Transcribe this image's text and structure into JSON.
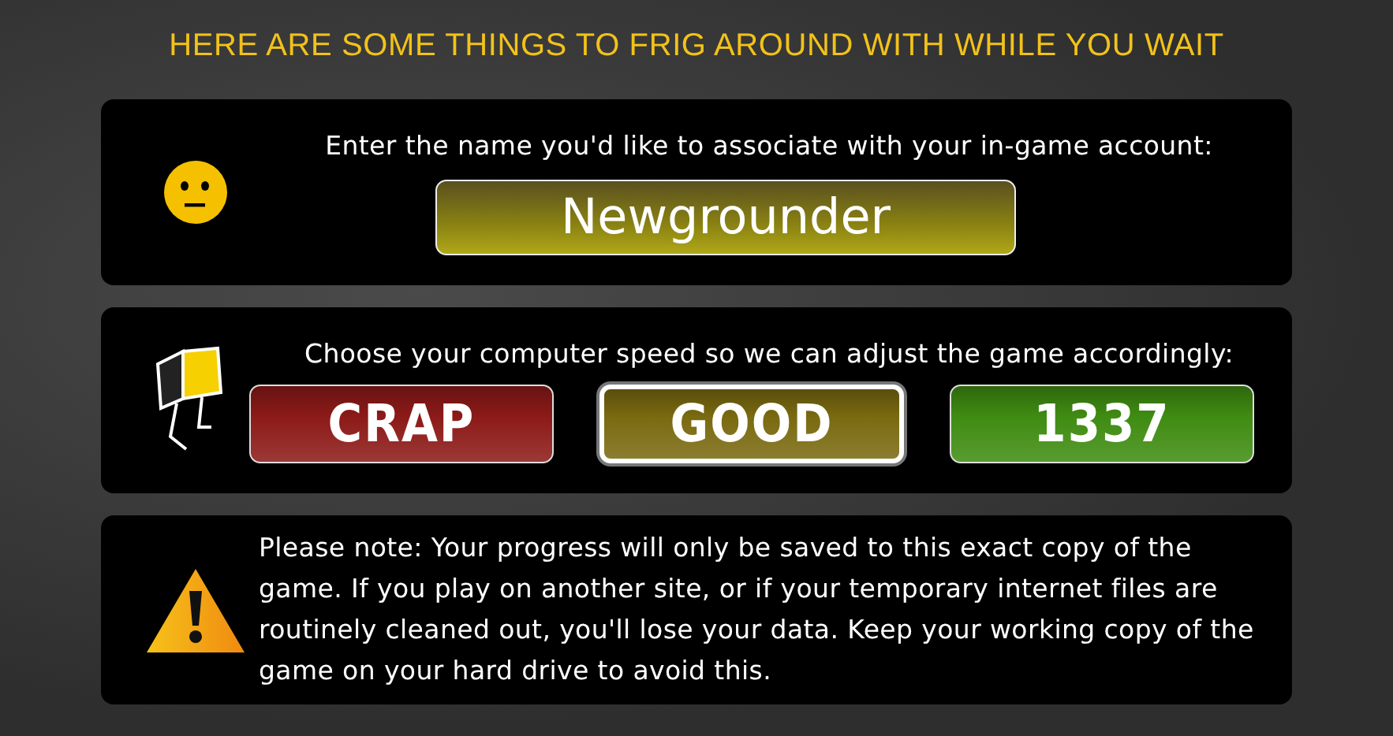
{
  "heading": "HERE ARE SOME THINGS TO FRIG AROUND WITH WHILE YOU WAIT",
  "name_panel": {
    "prompt": "Enter the name you'd like to associate with your in-game account:",
    "name_field": {
      "value": "Newgrounder"
    }
  },
  "speed_panel": {
    "prompt": "Choose your computer speed so we can adjust the game accordingly:",
    "options": [
      {
        "label": "CRAP",
        "color": "#8c1a18",
        "selected": false
      },
      {
        "label": "GOOD",
        "color": "#7a6a10",
        "selected": true
      },
      {
        "label": "1337",
        "color": "#3f8c12",
        "selected": false
      }
    ]
  },
  "note_panel": {
    "text": "Please note: Your progress will only be saved to this exact copy of the game. If you play on another site, or if your temporary internet files are routinely cleaned out, you'll lose your data. Keep your working copy of the game on your hard drive to avoid this."
  }
}
